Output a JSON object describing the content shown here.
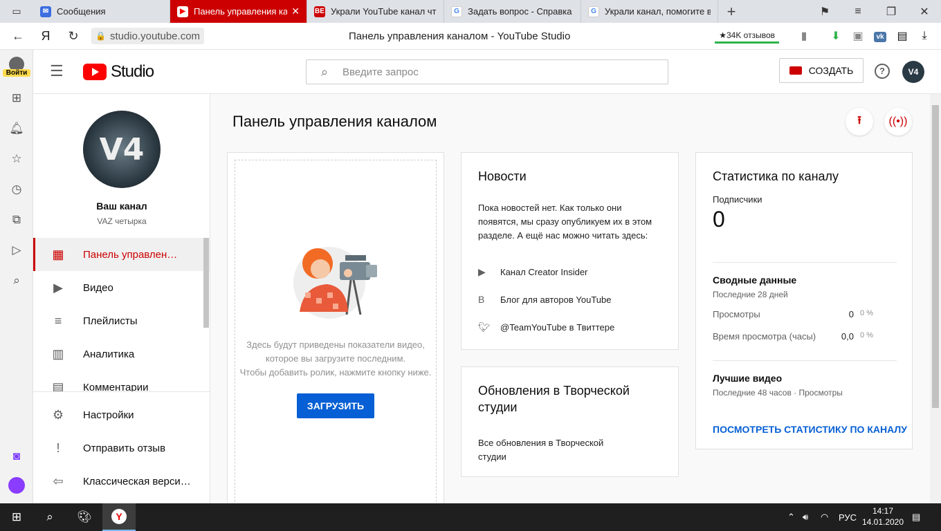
{
  "browser": {
    "tabs": [
      {
        "title": "Сообщения",
        "icon": "messages-icon",
        "color": "#3c6ee0",
        "active": false
      },
      {
        "title": "Панель управления канал",
        "icon": "youtube-icon",
        "color": "#ff0000",
        "active": true
      },
      {
        "title": "Украли YouTube канал что",
        "icon": "be-icon",
        "color": "#cc0000",
        "active": false
      },
      {
        "title": "Задать вопрос - Справка -",
        "icon": "google-icon",
        "color": "#4285f4",
        "active": false
      },
      {
        "title": "Украли канал, помогите во",
        "icon": "google-icon",
        "color": "#4285f4",
        "active": false
      }
    ],
    "url": "studio.youtube.com",
    "page_title": "Панель управления каналом - YouTube Studio",
    "reviews": "★34K отзывов",
    "yandex_letter": "Я"
  },
  "yandex_rail": {
    "login_label": "Войти"
  },
  "header": {
    "logo_text": "Studio",
    "search_placeholder": "Введите запрос",
    "create_label": "СОЗДАТЬ",
    "help": "?",
    "account_initials": "V4"
  },
  "sidebar": {
    "channel_title": "Ваш канал",
    "channel_name": "VAZ четырка",
    "avatar_text": "V4",
    "items": [
      {
        "label": "Панель управлен…",
        "icon": "dashboard-icon",
        "active": true
      },
      {
        "label": "Видео",
        "icon": "video-icon",
        "active": false
      },
      {
        "label": "Плейлисты",
        "icon": "playlists-icon",
        "active": false
      },
      {
        "label": "Аналитика",
        "icon": "analytics-icon",
        "active": false
      },
      {
        "label": "Комментарии",
        "icon": "comments-icon",
        "active": false
      }
    ],
    "bottom_items": [
      {
        "label": "Настройки",
        "icon": "settings-icon"
      },
      {
        "label": "Отправить отзыв",
        "icon": "feedback-icon"
      },
      {
        "label": "Классическая верси…",
        "icon": "classic-icon"
      }
    ]
  },
  "main": {
    "heading": "Панель управления каналом",
    "upload_card": {
      "text_lines": [
        "Здесь будут приведены показатели видео,",
        "которое вы загрузите последним.",
        "Чтобы добавить ролик, нажмите кнопку ниже."
      ],
      "button": "ЗАГРУЗИТЬ"
    },
    "news_card": {
      "title": "Новости",
      "text": "Пока новостей нет. Как только они появятся, мы сразу опубликуем их в этом разделе. А ещё нас можно читать здесь:",
      "links": [
        {
          "label": "Канал Creator Insider",
          "icon": "youtube-icon"
        },
        {
          "label": "Блог для авторов YouTube",
          "icon": "blogger-icon"
        },
        {
          "label": "@TeamYouTube в Твиттере",
          "icon": "twitter-icon"
        }
      ]
    },
    "updates_card": {
      "title": "Обновления в Творческой студии",
      "text": "Все обновления в Творческой студии"
    },
    "stats_card": {
      "title": "Статистика по каналу",
      "subscribers_label": "Подписчики",
      "subscribers_value": "0",
      "summary_title": "Сводные данные",
      "summary_period": "Последние 28 дней",
      "rows": [
        {
          "name": "Просмотры",
          "value": "0",
          "pct": "0 %"
        },
        {
          "name": "Время просмотра (часы)",
          "value": "0,0",
          "pct": "0 %"
        }
      ],
      "top_title": "Лучшие видео",
      "top_period": "Последние 48 часов · Просмотры",
      "link": "ПОСМОТРЕТЬ СТАТИСТИКУ ПО КАНАЛУ"
    }
  },
  "taskbar": {
    "lang": "РУС",
    "time": "14:17",
    "date": "14.01.2020"
  }
}
